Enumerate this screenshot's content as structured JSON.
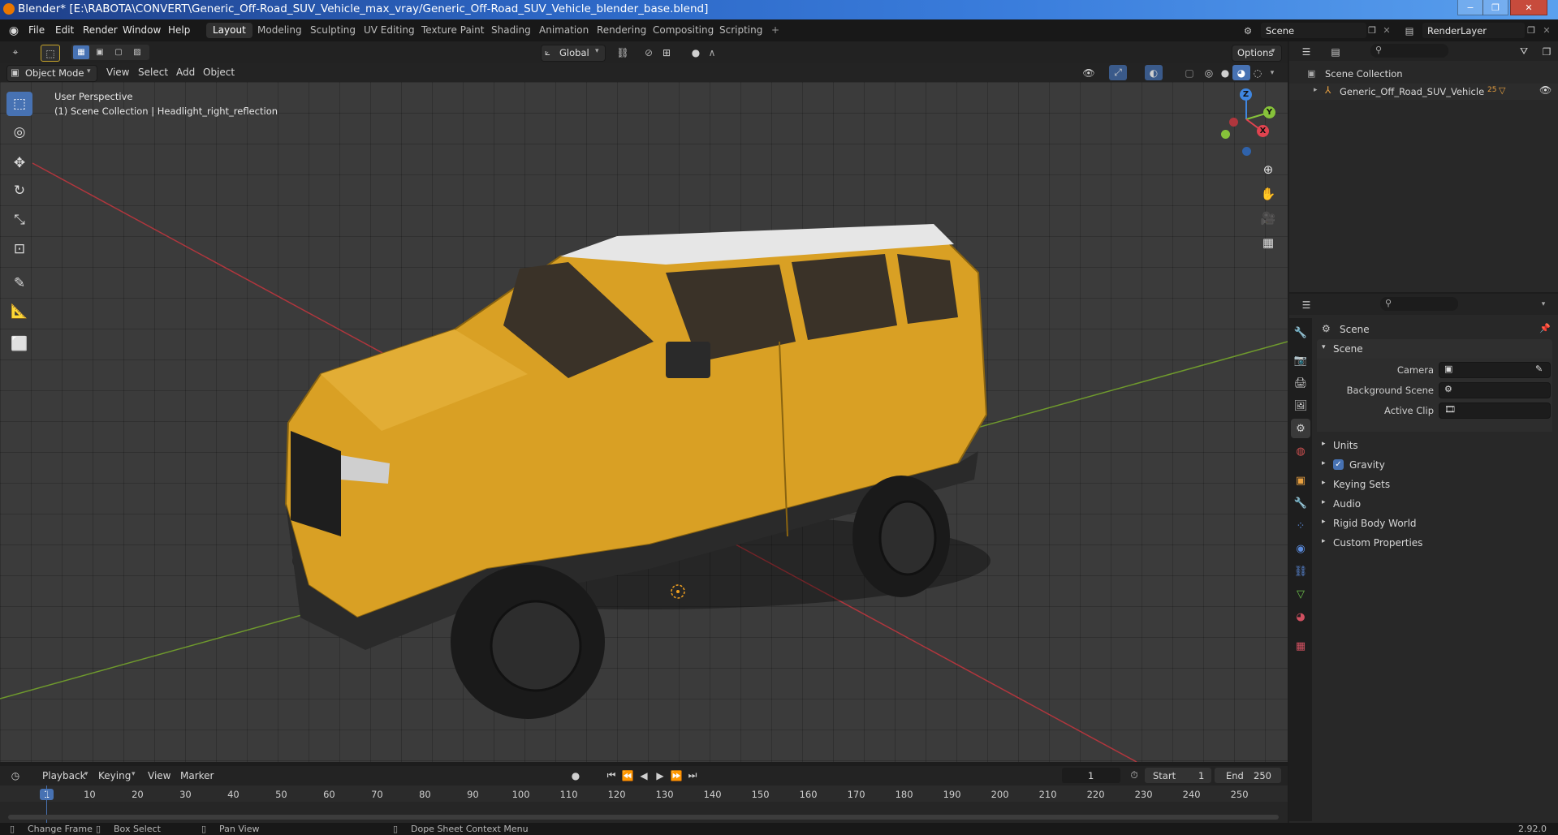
{
  "window": {
    "title": "Blender* [E:\\RABOTA\\CONVERT\\Generic_Off-Road_SUV_Vehicle_max_vray/Generic_Off-Road_SUV_Vehicle_blender_base.blend]",
    "minimize_icon": "−",
    "maximize_icon": "❐",
    "close_icon": "✕"
  },
  "menubar": {
    "items": [
      "File",
      "Edit",
      "Render",
      "Window",
      "Help"
    ],
    "workspaces": [
      "Layout",
      "Modeling",
      "Sculpting",
      "UV Editing",
      "Texture Paint",
      "Shading",
      "Animation",
      "Rendering",
      "Compositing",
      "Scripting"
    ],
    "active_workspace": "Layout",
    "add_workspace": "+",
    "scene_name": "Scene",
    "render_layer": "RenderLayer"
  },
  "viewport_header": {
    "mode": "Object Mode",
    "menus": [
      "View",
      "Select",
      "Add",
      "Object"
    ],
    "transform_orientation": "Global",
    "options": "Options"
  },
  "viewport": {
    "perspective": "User Perspective",
    "context": "(1) Scene Collection | Headlight_right_reflection",
    "gizmo": {
      "x": "X",
      "y": "Y",
      "z": "Z"
    }
  },
  "outliner": {
    "root": "Scene Collection",
    "items": [
      {
        "name": "Generic_Off_Road_SUV_Vehicle",
        "badge": "25"
      }
    ]
  },
  "properties": {
    "header": "Scene",
    "section": "Scene",
    "fields": [
      {
        "label": "Camera"
      },
      {
        "label": "Background Scene"
      },
      {
        "label": "Active Clip"
      }
    ],
    "panels": [
      "Units",
      "Gravity",
      "Keying Sets",
      "Audio",
      "Rigid Body World",
      "Custom Properties"
    ],
    "gravity_checked": true
  },
  "timeline": {
    "menus": [
      "Playback",
      "Keying",
      "View",
      "Marker"
    ],
    "current_frame": "1",
    "start_label": "Start",
    "start": "1",
    "end_label": "End",
    "end": "250",
    "ticks": [
      "1",
      "10",
      "20",
      "30",
      "40",
      "50",
      "60",
      "70",
      "80",
      "90",
      "100",
      "110",
      "120",
      "130",
      "140",
      "150",
      "160",
      "170",
      "180",
      "190",
      "200",
      "210",
      "220",
      "230",
      "240",
      "250"
    ]
  },
  "status": {
    "items": [
      "Change Frame",
      "Box Select",
      "Pan View",
      "Dope Sheet Context Menu"
    ],
    "version": "2.92.0"
  },
  "colors": {
    "accent": "#4772b3",
    "car_body": "#d9a024",
    "x_axis": "#e0434f",
    "y_axis": "#86c23a",
    "z_axis": "#3f86e0"
  }
}
